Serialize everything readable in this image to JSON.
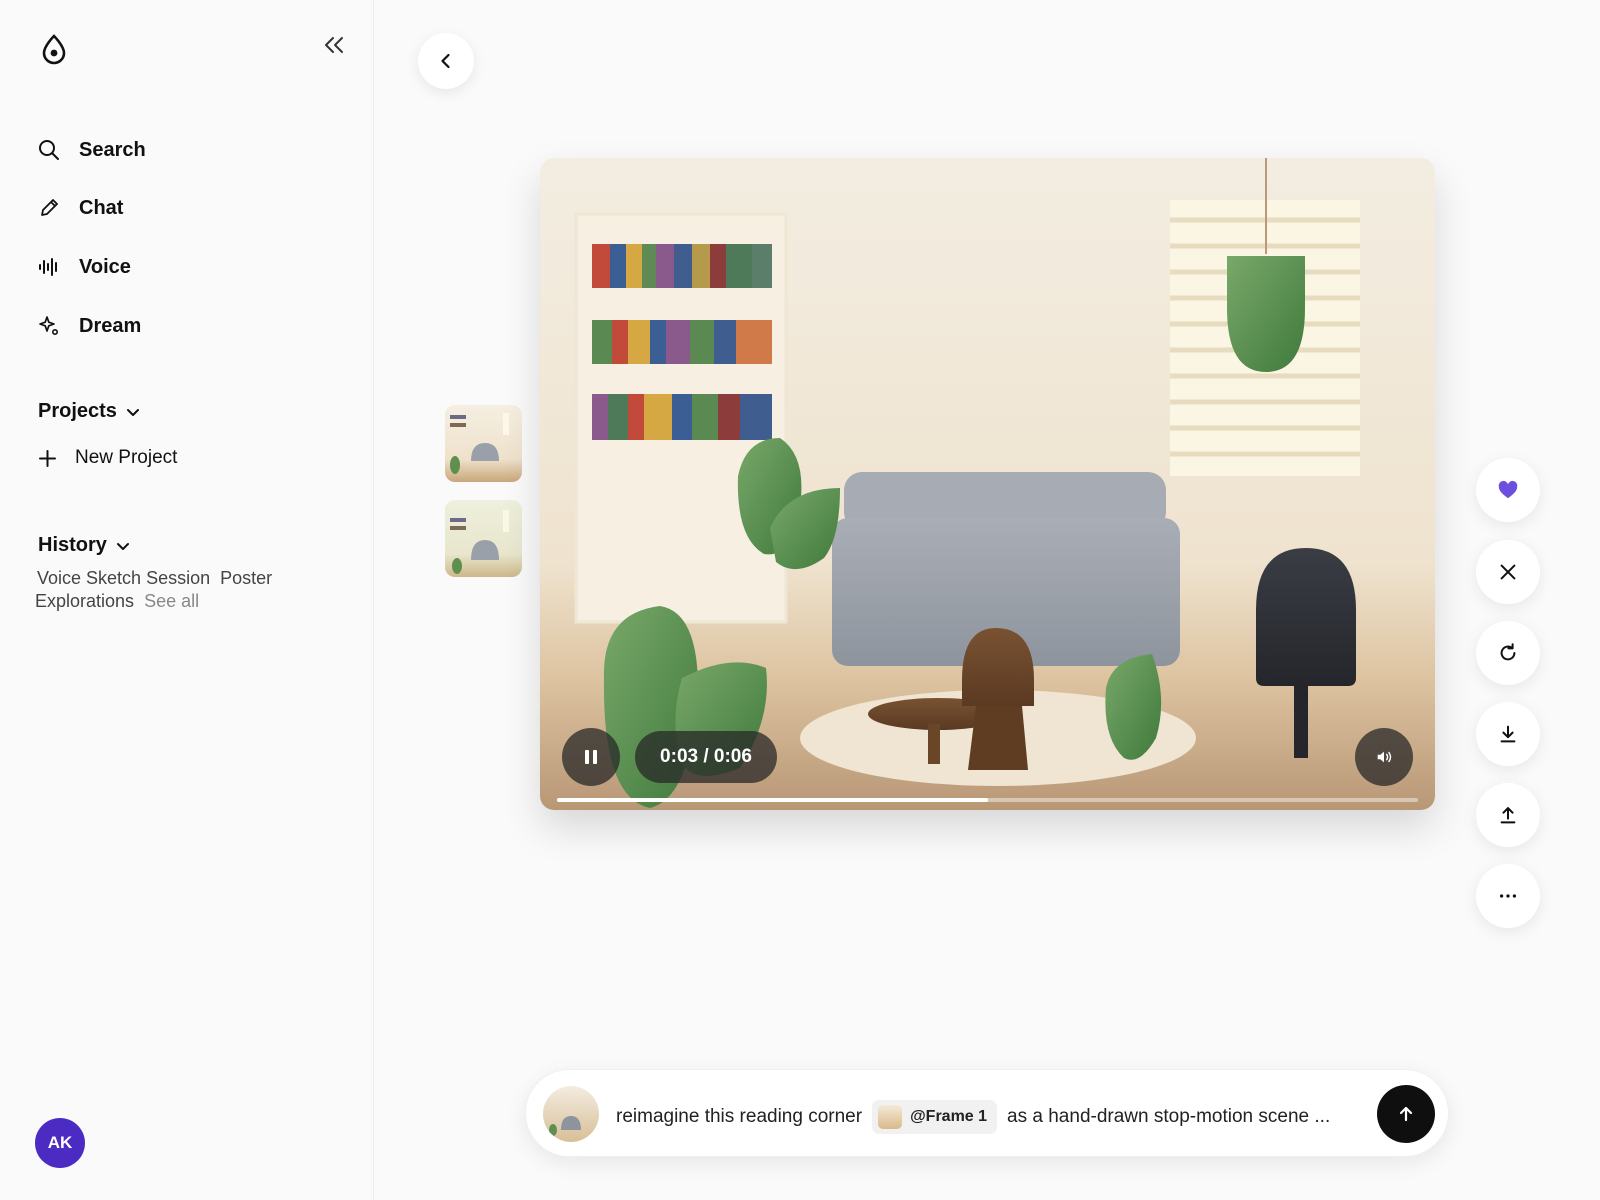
{
  "sidebar": {
    "nav": [
      {
        "label": "Search",
        "icon": "search-icon"
      },
      {
        "label": "Chat",
        "icon": "pencil-icon"
      },
      {
        "label": "Voice",
        "icon": "waveform-icon"
      },
      {
        "label": "Dream",
        "icon": "sparkle-icon"
      }
    ],
    "projects_label": "Projects",
    "new_project_label": "New Project",
    "history_label": "History",
    "history_items": [
      "Voice Sketch Session",
      "Poster Explorations"
    ],
    "see_all_label": "See all",
    "avatar_initials": "AK"
  },
  "player": {
    "time": "0:03 / 0:06",
    "progress_fraction": 0.5
  },
  "prompt": {
    "text_before": "reimagine this reading corner",
    "chip_label": "@Frame 1",
    "text_after": "as a hand-drawn stop-motion scene ..."
  },
  "colors": {
    "accent": "#4b2bc2",
    "heart": "#6d4fe0"
  }
}
